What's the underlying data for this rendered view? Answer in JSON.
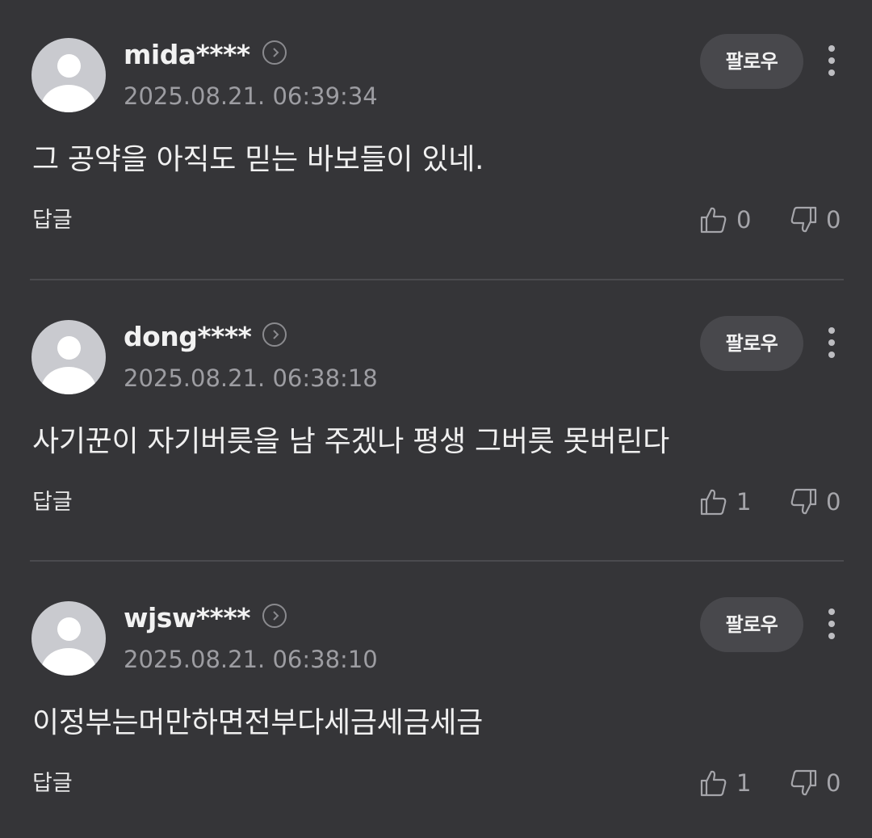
{
  "comments": [
    {
      "username": "mida****",
      "timestamp": "2025.08.21. 06:39:34",
      "follow_label": "팔로우",
      "content": "그 공약을 아직도 믿는 바보들이 있네.",
      "reply_label": "답글",
      "likes": "0",
      "dislikes": "0"
    },
    {
      "username": "dong****",
      "timestamp": "2025.08.21. 06:38:18",
      "follow_label": "팔로우",
      "content": "사기꾼이 자기버릇을 남 주겠나 평생 그버릇 못버린다",
      "reply_label": "답글",
      "likes": "1",
      "dislikes": "0"
    },
    {
      "username": "wjsw****",
      "timestamp": "2025.08.21. 06:38:10",
      "follow_label": "팔로우",
      "content": "이정부는머만하면전부다세금세금세금",
      "reply_label": "답글",
      "likes": "1",
      "dislikes": "0"
    }
  ],
  "icons": {
    "avatar": "default-avatar-icon",
    "profile": "chevron-right-circle-icon",
    "more": "vertical-ellipsis-icon",
    "like": "thumbs-up-icon",
    "dislike": "thumbs-down-icon"
  },
  "colors": {
    "background": "#353538",
    "button_bg": "#48484c",
    "muted_text": "#9d9da2",
    "divider": "#4b4b4f"
  }
}
